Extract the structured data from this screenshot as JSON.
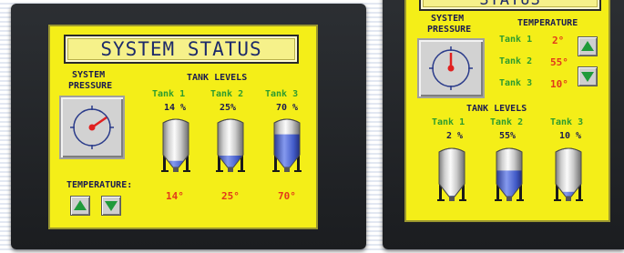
{
  "left": {
    "title": "SYSTEM STATUS",
    "pressure_label": [
      "SYSTEM",
      "PRESSURE"
    ],
    "levels_header": "TANK LEVELS",
    "tanks": [
      {
        "name": "Tank 1",
        "level_text": "14 %",
        "level": 0.14,
        "temp": "14°"
      },
      {
        "name": "Tank 2",
        "level_text": "25%",
        "level": 0.25,
        "temp": "25°"
      },
      {
        "name": "Tank 3",
        "level_text": "70 %",
        "level": 0.7,
        "temp": "70°"
      }
    ],
    "temperature_label": "TEMPERATURE:",
    "buttons": {
      "up_icon": "up-arrow-icon",
      "down_icon": "down-arrow-icon"
    }
  },
  "right": {
    "title": "STATUS",
    "pressure_label": [
      "SYSTEM",
      "PRESSURE"
    ],
    "temperature_header": "TEMPERATURE",
    "temps": [
      {
        "name": "Tank 1",
        "value": "2°"
      },
      {
        "name": "Tank 2",
        "value": "55°"
      },
      {
        "name": "Tank 3",
        "value": "10°"
      }
    ],
    "levels_header": "TANK LEVELS",
    "tanks": [
      {
        "name": "Tank 1",
        "level_text": "2 %",
        "level": 0.02
      },
      {
        "name": "Tank 2",
        "level_text": "55%",
        "level": 0.55
      },
      {
        "name": "Tank 3",
        "level_text": "10 %",
        "level": 0.1
      }
    ],
    "buttons": {
      "up_icon": "up-arrow-icon",
      "down_icon": "down-arrow-icon"
    }
  },
  "colors": {
    "screen": "#f4ee18",
    "tank_labels": "#2e9c2e",
    "temps": "#e23a1a",
    "fluid": "#3b55c8"
  }
}
